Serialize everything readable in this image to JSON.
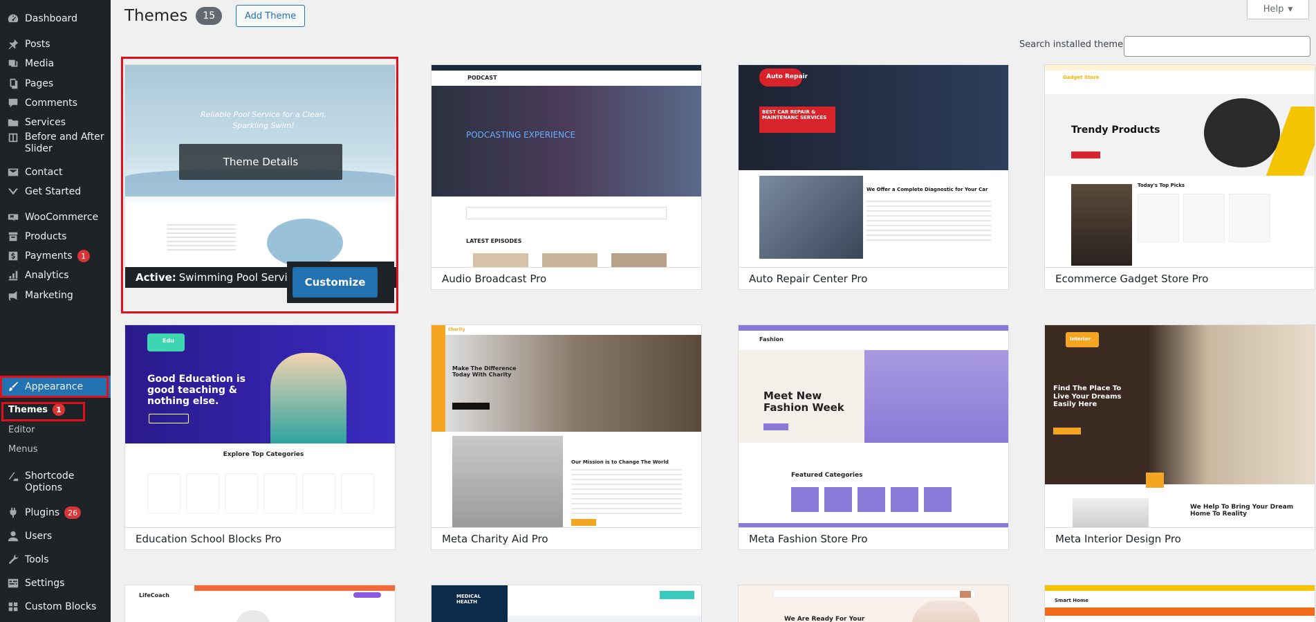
{
  "sidebar": {
    "items": [
      {
        "label": "Dashboard",
        "icon": "dashboard-icon"
      },
      {
        "label": "Posts",
        "icon": "pin-icon"
      },
      {
        "label": "Media",
        "icon": "media-icon"
      },
      {
        "label": "Pages",
        "icon": "pages-icon"
      },
      {
        "label": "Comments",
        "icon": "comment-icon"
      },
      {
        "label": "Services",
        "icon": "folder-icon"
      },
      {
        "label": "Before and After Slider",
        "icon": "slider-icon"
      },
      {
        "label": "Contact",
        "icon": "mail-icon"
      },
      {
        "label": "Get Started",
        "icon": "chevron-down-icon"
      },
      {
        "label": "WooCommerce",
        "icon": "woo-icon"
      },
      {
        "label": "Products",
        "icon": "archive-icon"
      },
      {
        "label": "Payments",
        "icon": "dollar-icon",
        "badge": "1"
      },
      {
        "label": "Analytics",
        "icon": "chart-icon"
      },
      {
        "label": "Marketing",
        "icon": "megaphone-icon"
      },
      {
        "label": "Appearance",
        "icon": "brush-icon"
      },
      {
        "label": "Shortcode Options",
        "icon": "shortcode-icon"
      },
      {
        "label": "Plugins",
        "icon": "plugin-icon",
        "badge": "26"
      },
      {
        "label": "Users",
        "icon": "user-icon"
      },
      {
        "label": "Tools",
        "icon": "wrench-icon"
      },
      {
        "label": "Settings",
        "icon": "settings-icon"
      },
      {
        "label": "Custom Blocks",
        "icon": "blocks-icon"
      }
    ],
    "submenu": {
      "themes_label": "Themes",
      "themes_badge": "1",
      "editor_label": "Editor",
      "menus_label": "Menus"
    }
  },
  "header": {
    "title": "Themes",
    "count": "15",
    "add_button": "Add Theme",
    "help_label": "Help",
    "search_label": "Search installed themes",
    "search_placeholder": ""
  },
  "active_theme": {
    "details_label": "Theme Details",
    "active_prefix": "Active:",
    "name": "Swimming Pool Service Pro",
    "customize_label": "Customize",
    "hero_line1": "Reliable Pool Service for a Clean,",
    "hero_line2": "Sparkling Swim!"
  },
  "themes": [
    {
      "name": "Audio Broadcast Pro",
      "brand": "PODCAST",
      "tag": "PODCASTING EXPERIENCE",
      "section": "LATEST EPISODES"
    },
    {
      "name": "Auto Repair Center Pro",
      "brand": "Auto Repair",
      "tag": "BEST CAR REPAIR & MAINTENANC SERVICES",
      "section": "We Offer a Complete Diagnostic for Your Car"
    },
    {
      "name": "Ecommerce Gadget Store Pro",
      "brand": "Gadget Store",
      "tag": "Trendy Products",
      "section": "Today's Top Picks"
    },
    {
      "name": "Education School Blocks Pro",
      "brand": "Edu",
      "tag": "Good Education is good teaching & nothing else.",
      "section": "Explore Top Categories"
    },
    {
      "name": "Meta Charity Aid Pro",
      "brand": "Charity",
      "tag": "Make The Difference Today With Charity",
      "section": "Our Mission is to Change The World"
    },
    {
      "name": "Meta Fashion Store Pro",
      "brand": "Fashion",
      "tag": "Meet New Fashion Week",
      "section": "Featured Categories"
    },
    {
      "name": "Meta Interior Design Pro",
      "brand": "Interior",
      "tag": "Find The Place To Live Your Dreams Easily Here",
      "section": "We Help To Bring Your Dream Home To Reality"
    },
    {
      "name": "",
      "brand": "LifeCoach",
      "tag": "",
      "section": ""
    },
    {
      "name": "",
      "brand": "MEDICAL HEALTH",
      "tag": "",
      "section": ""
    },
    {
      "name": "",
      "brand": "",
      "tag": "We Are Ready For Your",
      "section": ""
    },
    {
      "name": "",
      "brand": "Smart Home",
      "tag": "",
      "section": ""
    }
  ],
  "colors": {
    "sidebar_bg": "#1d2327",
    "accent": "#2271b1",
    "highlight": "#e0101a",
    "badge": "#d63638"
  }
}
